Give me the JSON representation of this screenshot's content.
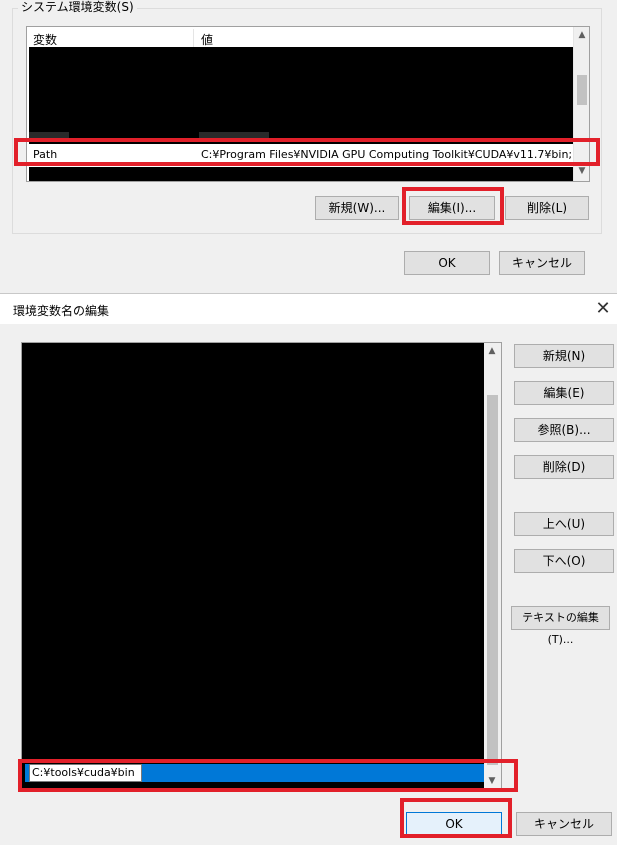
{
  "system_vars": {
    "group_title": "システム環境変数(S)",
    "columns": [
      "変数",
      "値"
    ],
    "path_row": {
      "name": "Path",
      "value": "C:¥Program Files¥NVIDIA GPU Computing Toolkit¥CUDA¥v11.7¥bin;..."
    },
    "buttons": {
      "new": "新規(W)...",
      "edit": "編集(I)...",
      "delete": "削除(L)"
    },
    "dialog_buttons": {
      "ok": "OK",
      "cancel": "キャンセル"
    }
  },
  "edit_dialog": {
    "title": "環境変数名の編集",
    "editing_value": "C:¥tools¥cuda¥bin",
    "side_buttons": {
      "new": "新規(N)",
      "edit": "編集(E)",
      "browse": "参照(B)...",
      "delete": "削除(D)",
      "up": "上へ(U)",
      "down": "下へ(O)",
      "edit_text": "テキストの編集(T)..."
    },
    "ok": "OK",
    "cancel": "キャンセル"
  },
  "icons": {
    "close": "close-icon",
    "scroll_up": "chevron-up-icon",
    "scroll_down": "chevron-down-icon"
  },
  "colors": {
    "highlight": "#e2202a",
    "selection": "#0078d7"
  }
}
